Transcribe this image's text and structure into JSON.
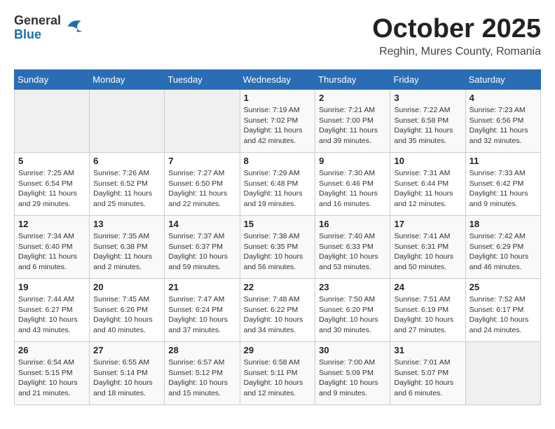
{
  "logo": {
    "general": "General",
    "blue": "Blue"
  },
  "header": {
    "month": "October 2025",
    "location": "Reghin, Mures County, Romania"
  },
  "weekdays": [
    "Sunday",
    "Monday",
    "Tuesday",
    "Wednesday",
    "Thursday",
    "Friday",
    "Saturday"
  ],
  "weeks": [
    [
      {
        "day": "",
        "info": ""
      },
      {
        "day": "",
        "info": ""
      },
      {
        "day": "",
        "info": ""
      },
      {
        "day": "1",
        "info": "Sunrise: 7:19 AM\nSunset: 7:02 PM\nDaylight: 11 hours and 42 minutes."
      },
      {
        "day": "2",
        "info": "Sunrise: 7:21 AM\nSunset: 7:00 PM\nDaylight: 11 hours and 39 minutes."
      },
      {
        "day": "3",
        "info": "Sunrise: 7:22 AM\nSunset: 6:58 PM\nDaylight: 11 hours and 35 minutes."
      },
      {
        "day": "4",
        "info": "Sunrise: 7:23 AM\nSunset: 6:56 PM\nDaylight: 11 hours and 32 minutes."
      }
    ],
    [
      {
        "day": "5",
        "info": "Sunrise: 7:25 AM\nSunset: 6:54 PM\nDaylight: 11 hours and 29 minutes."
      },
      {
        "day": "6",
        "info": "Sunrise: 7:26 AM\nSunset: 6:52 PM\nDaylight: 11 hours and 25 minutes."
      },
      {
        "day": "7",
        "info": "Sunrise: 7:27 AM\nSunset: 6:50 PM\nDaylight: 11 hours and 22 minutes."
      },
      {
        "day": "8",
        "info": "Sunrise: 7:29 AM\nSunset: 6:48 PM\nDaylight: 11 hours and 19 minutes."
      },
      {
        "day": "9",
        "info": "Sunrise: 7:30 AM\nSunset: 6:46 PM\nDaylight: 11 hours and 16 minutes."
      },
      {
        "day": "10",
        "info": "Sunrise: 7:31 AM\nSunset: 6:44 PM\nDaylight: 11 hours and 12 minutes."
      },
      {
        "day": "11",
        "info": "Sunrise: 7:33 AM\nSunset: 6:42 PM\nDaylight: 11 hours and 9 minutes."
      }
    ],
    [
      {
        "day": "12",
        "info": "Sunrise: 7:34 AM\nSunset: 6:40 PM\nDaylight: 11 hours and 6 minutes."
      },
      {
        "day": "13",
        "info": "Sunrise: 7:35 AM\nSunset: 6:38 PM\nDaylight: 11 hours and 2 minutes."
      },
      {
        "day": "14",
        "info": "Sunrise: 7:37 AM\nSunset: 6:37 PM\nDaylight: 10 hours and 59 minutes."
      },
      {
        "day": "15",
        "info": "Sunrise: 7:38 AM\nSunset: 6:35 PM\nDaylight: 10 hours and 56 minutes."
      },
      {
        "day": "16",
        "info": "Sunrise: 7:40 AM\nSunset: 6:33 PM\nDaylight: 10 hours and 53 minutes."
      },
      {
        "day": "17",
        "info": "Sunrise: 7:41 AM\nSunset: 6:31 PM\nDaylight: 10 hours and 50 minutes."
      },
      {
        "day": "18",
        "info": "Sunrise: 7:42 AM\nSunset: 6:29 PM\nDaylight: 10 hours and 46 minutes."
      }
    ],
    [
      {
        "day": "19",
        "info": "Sunrise: 7:44 AM\nSunset: 6:27 PM\nDaylight: 10 hours and 43 minutes."
      },
      {
        "day": "20",
        "info": "Sunrise: 7:45 AM\nSunset: 6:26 PM\nDaylight: 10 hours and 40 minutes."
      },
      {
        "day": "21",
        "info": "Sunrise: 7:47 AM\nSunset: 6:24 PM\nDaylight: 10 hours and 37 minutes."
      },
      {
        "day": "22",
        "info": "Sunrise: 7:48 AM\nSunset: 6:22 PM\nDaylight: 10 hours and 34 minutes."
      },
      {
        "day": "23",
        "info": "Sunrise: 7:50 AM\nSunset: 6:20 PM\nDaylight: 10 hours and 30 minutes."
      },
      {
        "day": "24",
        "info": "Sunrise: 7:51 AM\nSunset: 6:19 PM\nDaylight: 10 hours and 27 minutes."
      },
      {
        "day": "25",
        "info": "Sunrise: 7:52 AM\nSunset: 6:17 PM\nDaylight: 10 hours and 24 minutes."
      }
    ],
    [
      {
        "day": "26",
        "info": "Sunrise: 6:54 AM\nSunset: 5:15 PM\nDaylight: 10 hours and 21 minutes."
      },
      {
        "day": "27",
        "info": "Sunrise: 6:55 AM\nSunset: 5:14 PM\nDaylight: 10 hours and 18 minutes."
      },
      {
        "day": "28",
        "info": "Sunrise: 6:57 AM\nSunset: 5:12 PM\nDaylight: 10 hours and 15 minutes."
      },
      {
        "day": "29",
        "info": "Sunrise: 6:58 AM\nSunset: 5:11 PM\nDaylight: 10 hours and 12 minutes."
      },
      {
        "day": "30",
        "info": "Sunrise: 7:00 AM\nSunset: 5:09 PM\nDaylight: 10 hours and 9 minutes."
      },
      {
        "day": "31",
        "info": "Sunrise: 7:01 AM\nSunset: 5:07 PM\nDaylight: 10 hours and 6 minutes."
      },
      {
        "day": "",
        "info": ""
      }
    ]
  ]
}
